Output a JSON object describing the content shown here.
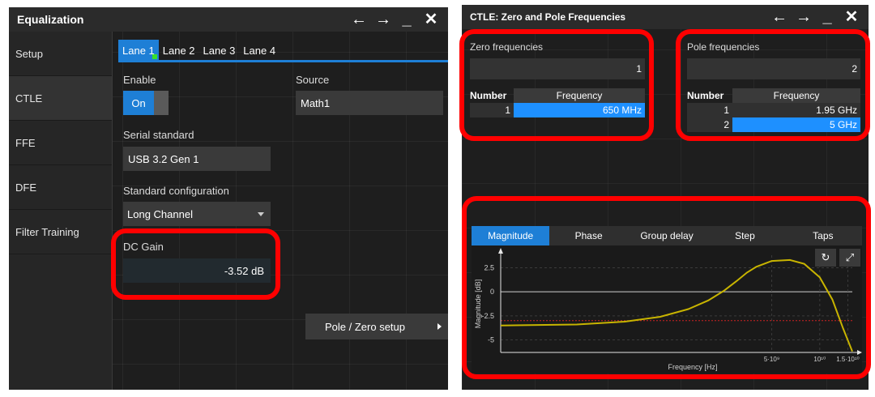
{
  "left": {
    "title": "Equalization",
    "sidebar": [
      {
        "label": "Setup"
      },
      {
        "label": "CTLE"
      },
      {
        "label": "FFE"
      },
      {
        "label": "DFE"
      },
      {
        "label": "Filter Training"
      }
    ],
    "lanes": [
      "Lane 1",
      "Lane 2",
      "Lane 3",
      "Lane 4"
    ],
    "enable_label": "Enable",
    "enable_value": "On",
    "source_label": "Source",
    "source_value": "Math1",
    "serial_label": "Serial standard",
    "serial_value": "USB 3.2 Gen 1",
    "config_label": "Standard configuration",
    "config_value": "Long Channel",
    "dcgain_label": "DC Gain",
    "dcgain_value": "-3.52 dB",
    "pz_button": "Pole / Zero setup"
  },
  "right": {
    "title": "CTLE: Zero and Pole Frequencies",
    "zero_label": "Zero frequencies",
    "zero_count": "1",
    "pole_label": "Pole frequencies",
    "pole_count": "2",
    "col_number": "Number",
    "col_frequency": "Frequency",
    "zeros": [
      {
        "number": "1",
        "frequency": "650 MHz"
      }
    ],
    "poles": [
      {
        "number": "1",
        "frequency": "1.95 GHz"
      },
      {
        "number": "2",
        "frequency": "5 GHz"
      }
    ],
    "plot_tabs": [
      "Magnitude",
      "Phase",
      "Group delay",
      "Step",
      "Taps"
    ]
  },
  "icons": {
    "back": "arrow-left-icon",
    "forward": "arrow-right-icon",
    "minimize": "minimize-icon",
    "close": "close-icon",
    "undo": "undo-icon",
    "expand": "expand-icon"
  },
  "colors": {
    "accent": "#1e7fd6",
    "selected_cell": "#1e90ff",
    "curve": "#c8b400",
    "highlight": "#ff0000",
    "ref_line": "#cc2222"
  },
  "chart_data": {
    "type": "line",
    "xlabel": "Frequency [Hz]",
    "ylabel": "Magnitude [dB]",
    "x_scale": "log",
    "x_ticks": [
      "5·10⁹",
      "10¹⁰",
      "1.5·10¹⁰"
    ],
    "x_tick_values": [
      5000000000,
      10000000000,
      15000000000
    ],
    "y_ticks": [
      "2.5",
      "0",
      "-2.5",
      "-5"
    ],
    "y_tick_values": [
      2.5,
      0,
      -2.5,
      -5
    ],
    "ylim": [
      -6.3,
      3.8
    ],
    "xlim": [
      100000000,
      16000000000
    ],
    "reference_line_y": -3,
    "series": [
      {
        "x": [
          100000000,
          300000000,
          600000000,
          1000000000,
          1500000000,
          2000000000,
          2500000000,
          3000000000,
          3500000000,
          4000000000,
          5000000000,
          6500000000,
          8000000000,
          10000000000,
          12000000000,
          14000000000,
          16000000000
        ],
        "y": [
          -3.5,
          -3.4,
          -3.1,
          -2.6,
          -1.8,
          -0.9,
          0.1,
          1.1,
          2.0,
          2.6,
          3.2,
          3.3,
          2.9,
          1.5,
          -0.8,
          -3.8,
          -6.2
        ]
      }
    ]
  }
}
